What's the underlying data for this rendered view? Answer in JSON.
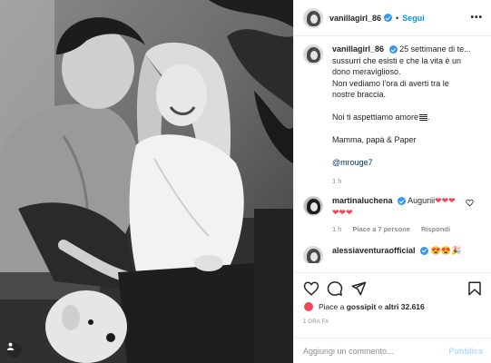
{
  "post": {
    "author": "vanillagirl_86",
    "follow_label": "Segui",
    "dot": "•",
    "more": "•••"
  },
  "caption": {
    "username": "vanillagirl_86",
    "lines": [
      "25 settimane di te...",
      "sussurri che esisti e che la vita è un",
      "dono meraviglioso.",
      "Non vediamo l'ora di averti tra le",
      "nostre braccia.",
      "Noi ti aspettiamo amore",
      "Mamma, papà & Paper",
      "@mrouge7"
    ],
    "time": "1 h"
  },
  "comments": [
    {
      "username": "martinaluchena",
      "text": "Auguriii",
      "hearts_line1": "❤❤❤",
      "hearts_line2": "❤❤❤",
      "time": "1 h",
      "likes": "Piace a 7 persone",
      "reply": "Rispondi",
      "like_icon": "heart-outline-icon"
    },
    {
      "username": "alessiaventuraofficial",
      "text": "😍😍🎉"
    }
  ],
  "likes": {
    "prefix": "Piace a",
    "first": "gossipit",
    "middle": "e",
    "others": "altri 32.616"
  },
  "date": "1 ORA FA",
  "add_comment": {
    "placeholder": "Aggiungi un commento...",
    "publish": "Pubblica"
  },
  "icons": [
    "heart-outline-icon",
    "comment-icon",
    "share-icon",
    "bookmark-icon",
    "user-tag-icon",
    "more-icon"
  ],
  "colors": {
    "accent": "#0095f6",
    "verified": "#3897f0",
    "heart": "#ed4956",
    "muted": "#8e8e8e",
    "publish_disabled": "#b2dffc"
  }
}
